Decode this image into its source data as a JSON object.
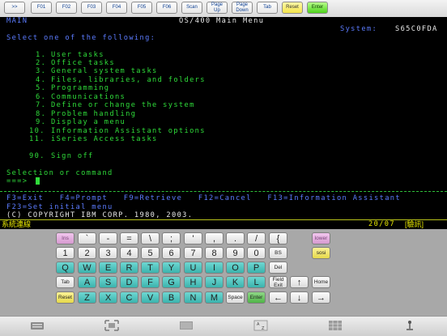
{
  "toolbar": {
    "buttons": [
      ">>",
      "F01",
      "F02",
      "F03",
      "F04",
      "F05",
      "F06",
      "Scan",
      "Page Up",
      "Page Down",
      "Tab",
      "Reset",
      "Enter"
    ]
  },
  "terminal": {
    "menu_id": "MAIN",
    "title": "OS/400 Main Menu",
    "system_label": "System:",
    "system_name": "S65C0FDA",
    "prompt": "Select one of the following:",
    "options": [
      {
        "num": "1.",
        "label": "User tasks"
      },
      {
        "num": "2.",
        "label": "Office tasks"
      },
      {
        "num": "3.",
        "label": "General system tasks"
      },
      {
        "num": "4.",
        "label": "Files, libraries, and folders"
      },
      {
        "num": "5.",
        "label": "Programming"
      },
      {
        "num": "6.",
        "label": "Communications"
      },
      {
        "num": "7.",
        "label": "Define or change the system"
      },
      {
        "num": "8.",
        "label": "Problem handling"
      },
      {
        "num": "9.",
        "label": "Display a menu"
      },
      {
        "num": "10.",
        "label": "Information Assistant options"
      },
      {
        "num": "11.",
        "label": "iSeries Access tasks"
      },
      {
        "num": "90.",
        "label": "Sign off"
      }
    ],
    "selection_label": "Selection or command",
    "input_prompt": "===>",
    "fkeys_line1": "F3=Exit   F4=Prompt   F9=Retrieve   F12=Cancel   F13=Information Assistant",
    "fkeys_line2": "F23=Set initial menu",
    "copyright": "(C) COPYRIGHT IBM CORP. 1980, 2003."
  },
  "status_bar": {
    "connection": "系統連線",
    "position": "20/07",
    "mode": "[驗訊]"
  },
  "keyboard": {
    "row1": [
      "Ins",
      "`",
      "-",
      "=",
      "\\",
      ";",
      "'",
      ",",
      ".",
      "/",
      "{"
    ],
    "row1_right": [
      "lower"
    ],
    "row2": [
      "1",
      "2",
      "3",
      "4",
      "5",
      "6",
      "7",
      "8",
      "9",
      "0",
      "BS"
    ],
    "row2_right": [
      "sosi"
    ],
    "row3": [
      "Q",
      "W",
      "E",
      "R",
      "T",
      "Y",
      "U",
      "I",
      "O",
      "P",
      "Del"
    ],
    "row4": [
      "Tab",
      "A",
      "S",
      "D",
      "F",
      "G",
      "H",
      "J",
      "K",
      "L",
      "Field Exit",
      "↑",
      "Home"
    ],
    "row5": [
      "Reset",
      "Z",
      "X",
      "C",
      "V",
      "B",
      "N",
      "M",
      "Space",
      "Enter",
      "←",
      "↓",
      "→"
    ]
  },
  "bottom_icons": [
    "keyboard-icon",
    "fullscreen-icon",
    "barcode-icon",
    "az-sort-icon",
    "grid-keypad-icon",
    "joystick-icon"
  ]
}
